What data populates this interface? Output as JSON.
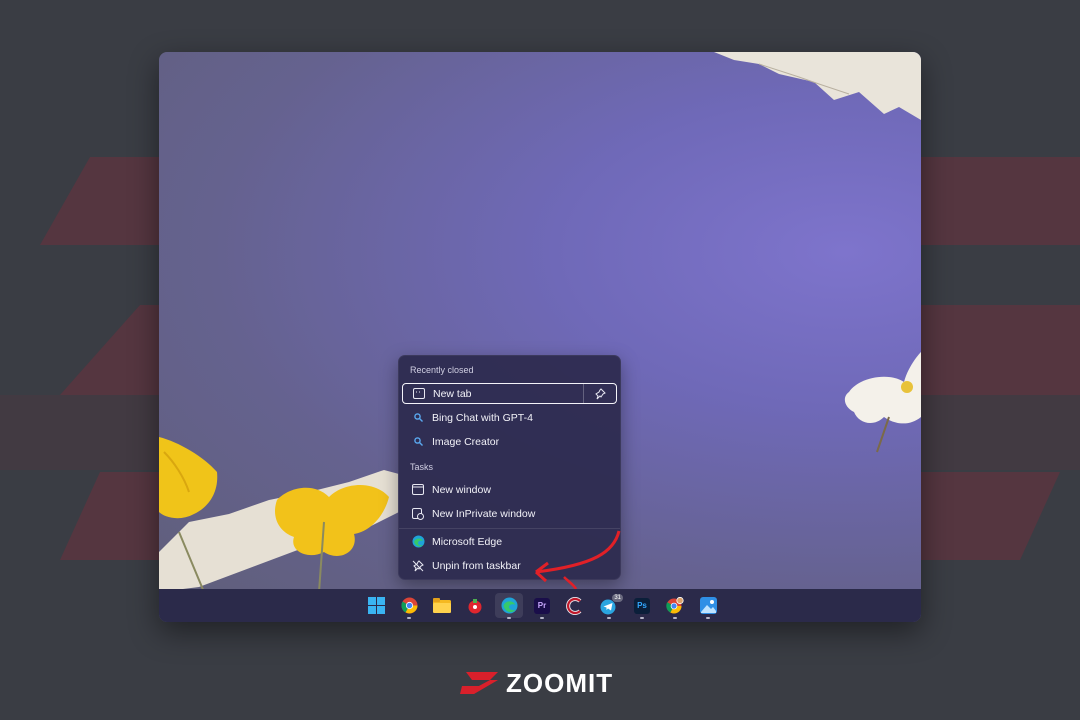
{
  "jump_list": {
    "recently_closed_header": "Recently closed",
    "recent_items": [
      {
        "label": "New tab",
        "icon": "tab-icon"
      },
      {
        "label": "Bing Chat with GPT-4",
        "icon": "search-icon"
      },
      {
        "label": "Image Creator",
        "icon": "search-icon"
      }
    ],
    "tasks_header": "Tasks",
    "tasks": [
      {
        "label": "New window",
        "icon": "window-icon"
      },
      {
        "label": "New InPrivate window",
        "icon": "inprivate-window-icon"
      }
    ],
    "app": {
      "label": "Microsoft Edge",
      "icon": "edge-icon"
    },
    "unpin": {
      "label": "Unpin from taskbar",
      "icon": "unpin-icon"
    }
  },
  "taskbar": {
    "apps": [
      {
        "name": "Start",
        "icon": "windows-start-icon"
      },
      {
        "name": "Chrome",
        "icon": "chrome-icon"
      },
      {
        "name": "File Explorer",
        "icon": "folder-icon"
      },
      {
        "name": "App",
        "icon": "red-app-icon"
      },
      {
        "name": "Microsoft Edge",
        "icon": "edge-icon",
        "active": true
      },
      {
        "name": "Premiere Pro",
        "icon": "premiere-icon",
        "label": "Pr"
      },
      {
        "name": "App",
        "icon": "red-c-icon"
      },
      {
        "name": "Telegram",
        "icon": "telegram-icon",
        "badge": "31"
      },
      {
        "name": "Photoshop",
        "icon": "photoshop-icon",
        "label": "Ps"
      },
      {
        "name": "Chrome Profile",
        "icon": "chrome-profile-icon"
      },
      {
        "name": "Photos",
        "icon": "photos-icon"
      }
    ]
  },
  "brand": {
    "name": "ZOOMIT",
    "accent": "#d9202b"
  },
  "colors": {
    "menu_bg": "#2c2a4e",
    "taskbar_bg": "#2b2a4a",
    "accent_edge": "#0f8bd6"
  }
}
